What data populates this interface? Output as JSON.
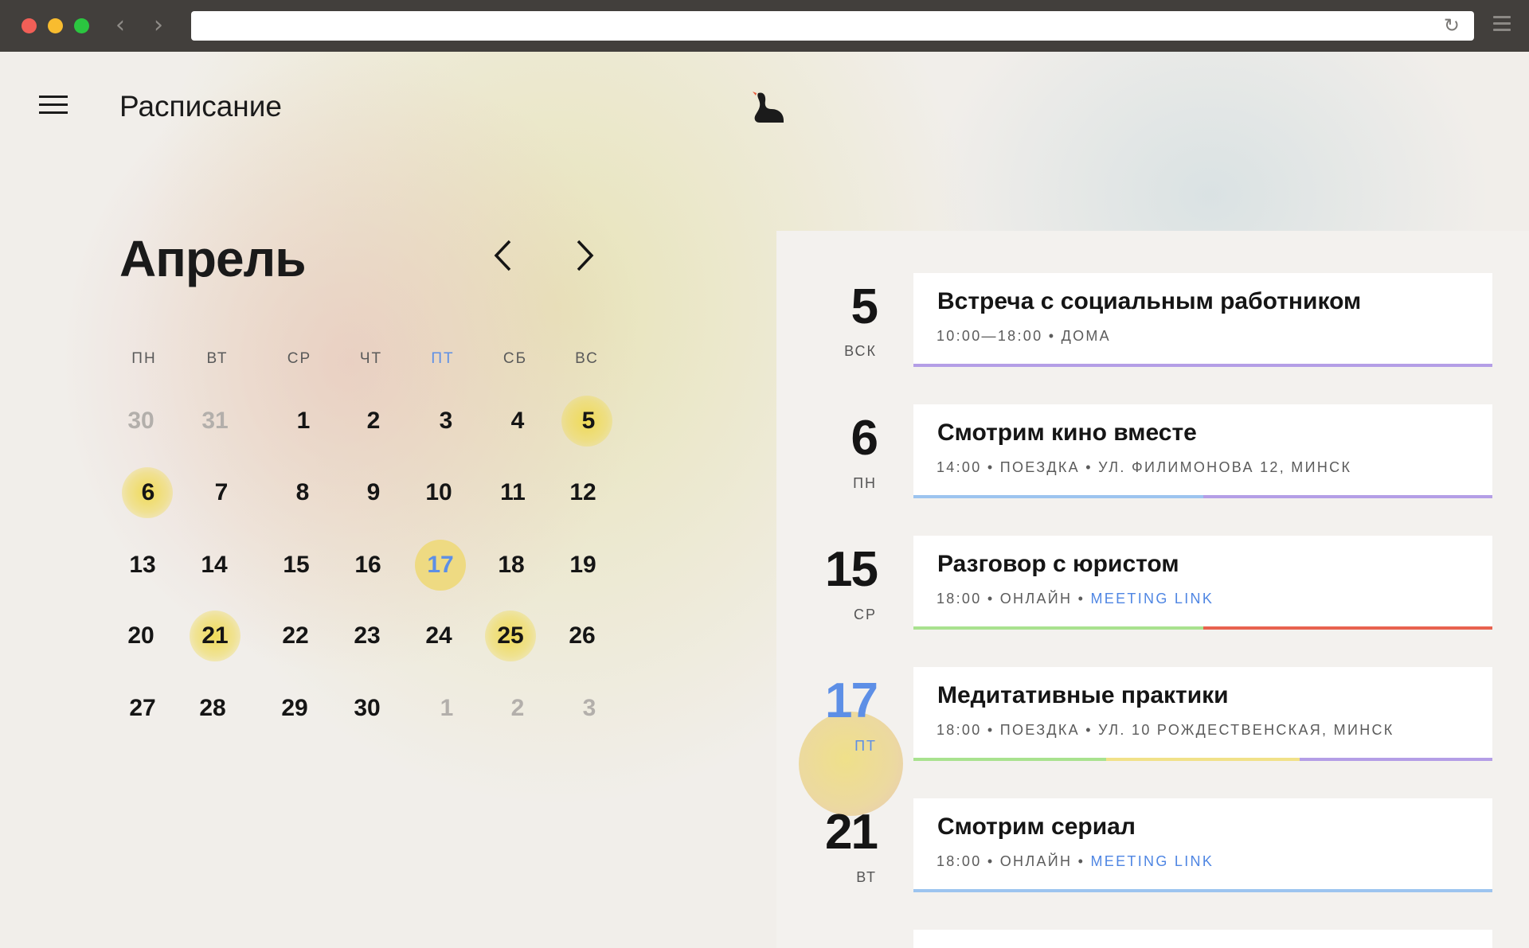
{
  "app": {
    "title": "Расписание"
  },
  "calendar": {
    "month": "Апрель",
    "weekdays": [
      "ПН",
      "ВТ",
      "СР",
      "ЧТ",
      "ПТ",
      "СБ",
      "ВС"
    ],
    "rows": [
      [
        "30",
        "31",
        "1",
        "2",
        "3",
        "4",
        "5"
      ],
      [
        "6",
        "7",
        "8",
        "9",
        "10",
        "11",
        "12"
      ],
      [
        "13",
        "14",
        "15",
        "16",
        "17",
        "18",
        "19"
      ],
      [
        "20",
        "21",
        "22",
        "23",
        "24",
        "25",
        "26"
      ],
      [
        "27",
        "28",
        "29",
        "30",
        "1",
        "2",
        "3"
      ]
    ]
  },
  "events": [
    {
      "day_num": "5",
      "day_name": "ВСК",
      "title": "Встреча с социальным работником",
      "meta": "10:00—18:00 • ДОМА",
      "link": ""
    },
    {
      "day_num": "6",
      "day_name": "ПН",
      "title": "Смотрим кино вместе",
      "meta": "14:00 • ПОЕЗДКА • УЛ. ФИЛИМОНОВА 12, МИНСК",
      "link": ""
    },
    {
      "day_num": "15",
      "day_name": "СР",
      "title": "Разговор с юристом",
      "meta": "18:00 • ОНЛАЙН • ",
      "link": "MEETING LINK"
    },
    {
      "day_num": "17",
      "day_name": "ПТ",
      "title": "Медитативные практики",
      "meta": "18:00 • ПОЕЗДКА • УЛ. 10 РОЖДЕСТВЕНСКАЯ, МИНСК",
      "link": ""
    },
    {
      "day_num": "21",
      "day_name": "ВТ",
      "title": "Смотрим сериал",
      "meta": "18:00 • ОНЛАЙН • ",
      "link": "MEETING LINK"
    }
  ],
  "colors": {
    "accent": "#5d8fe6",
    "highlight": "#f0da50",
    "bar_purple": "#b49ee6",
    "bar_blue": "#9cc4ef",
    "bar_green": "#a9e28f",
    "bar_red": "#e8624f",
    "bar_yellow": "#f1e189"
  },
  "icons": {
    "menu": "hamburger-icon",
    "logo": "bird-logo-icon",
    "prev": "chevron-left-icon",
    "next": "chevron-right-icon"
  }
}
